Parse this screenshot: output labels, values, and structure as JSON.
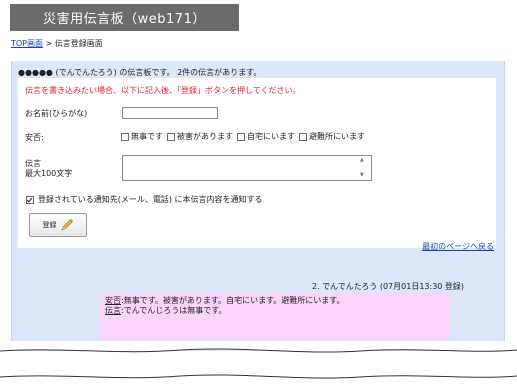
{
  "header": {
    "title": "災害用伝言板（web171）"
  },
  "breadcrumb": {
    "home_link": "TOP画面",
    "separator": " > ",
    "current": "伝言登録画面"
  },
  "board": {
    "info_line": "●●●●● (でんでんたろう) の伝言板です。 2件の伝言があります。"
  },
  "form": {
    "instruction": "伝言を書き込みたい場合、以下に記入後、「登録」ボタンを押してください。",
    "name_label": "お名前(ひらがな)",
    "name_value": "",
    "status_label": "安否:",
    "status_options": [
      {
        "label": "無事です",
        "checked": false
      },
      {
        "label": "被害があります",
        "checked": false
      },
      {
        "label": "自宅にいます",
        "checked": false
      },
      {
        "label": "避難所にいます",
        "checked": false
      }
    ],
    "message_label_line1": "伝言",
    "message_label_line2": "最大100文字",
    "message_value": "",
    "notify_label": "登録されている通知先(メール、電話) に本伝言内容を通知する",
    "notify_checked": true,
    "register_button": "登録",
    "back_link": "最初のページへ戻る"
  },
  "entries": [
    {
      "header": "2. でんでんたろう (07月01日13:30 登録)",
      "status_key": "安否",
      "status_text": ":無事です。被害があります。自宅にいます。避難所にいます。",
      "message_key": "伝言",
      "message_text": ":でんでんじろうは無事です。"
    }
  ],
  "colors": {
    "panel_bg": "#dde7fb",
    "entry_bg": "#fcd4fd",
    "instruction": "#e8202a",
    "header_bg": "#6b6b6b",
    "link": "#1a3fb0"
  }
}
